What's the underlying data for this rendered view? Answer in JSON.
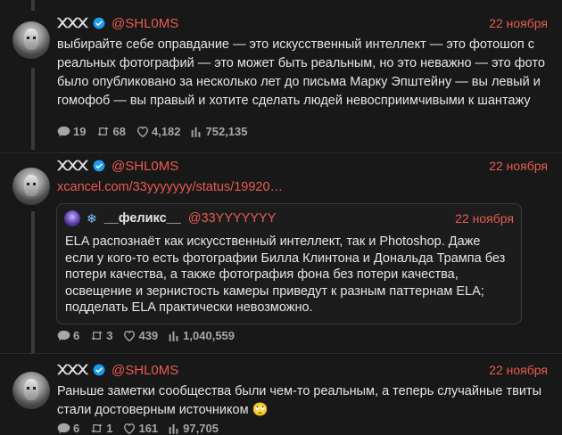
{
  "tweets": [
    {
      "author": {
        "display_name": "᙭᙭᙭",
        "handle": "@SHL0MS",
        "avatar_icon": "alien-face-icon",
        "verified_icon": "verified-badge-icon"
      },
      "date": "22 ноября",
      "text": "выбирайте себе оправдание — это искусственный интеллект — это фотошоп с реальных фотографий — это может быть реальным, но это неважно — это фото было опубликовано за несколько лет до письма Марку Эпштейну — вы левый и гомофоб — вы правый и хотите сделать людей невосприимчивыми к шантажу",
      "stats": {
        "replies": "19",
        "retweets": "68",
        "likes": "4,182",
        "views": "752,135"
      }
    },
    {
      "author": {
        "display_name": "᙭᙭᙭",
        "handle": "@SHL0MS",
        "avatar_icon": "alien-face-icon",
        "verified_icon": "verified-badge-icon"
      },
      "date": "22 ноября",
      "link": "xcancel.com/33yyyyyyy/status/19920…",
      "quote": {
        "snow_icon": "❄",
        "name": "__феликс__",
        "handle": "@33YYYYYYY",
        "date": "22 ноября",
        "text": "ELA распознаёт как искусственный интеллект, так и Photoshop. Даже если у кого-то есть фотографии Билла Клинтона и Дональда Трампа без потери качества, а также фотография фона без потери качества, освещение и зернистость камеры приведут к разным паттернам ELA; подделать ELA практически невозможно."
      },
      "stats": {
        "replies": "6",
        "retweets": "3",
        "likes": "439",
        "views": "1,040,559"
      }
    },
    {
      "author": {
        "display_name": "᙭᙭᙭",
        "handle": "@SHL0MS",
        "avatar_icon": "alien-face-icon",
        "verified_icon": "verified-badge-icon"
      },
      "date": "22 ноября",
      "text": "Раньше заметки сообщества были чем-то реальным, а теперь случайные твиты стали достоверным источником 🙄",
      "stats": {
        "replies": "6",
        "retweets": "1",
        "likes": "161",
        "views": "97,705"
      }
    }
  ],
  "colors": {
    "accent": "#ea5b4f",
    "background": "#181818",
    "text": "#e6e6e6",
    "muted": "#a6a6a6",
    "verified": "#1d9bf0"
  }
}
